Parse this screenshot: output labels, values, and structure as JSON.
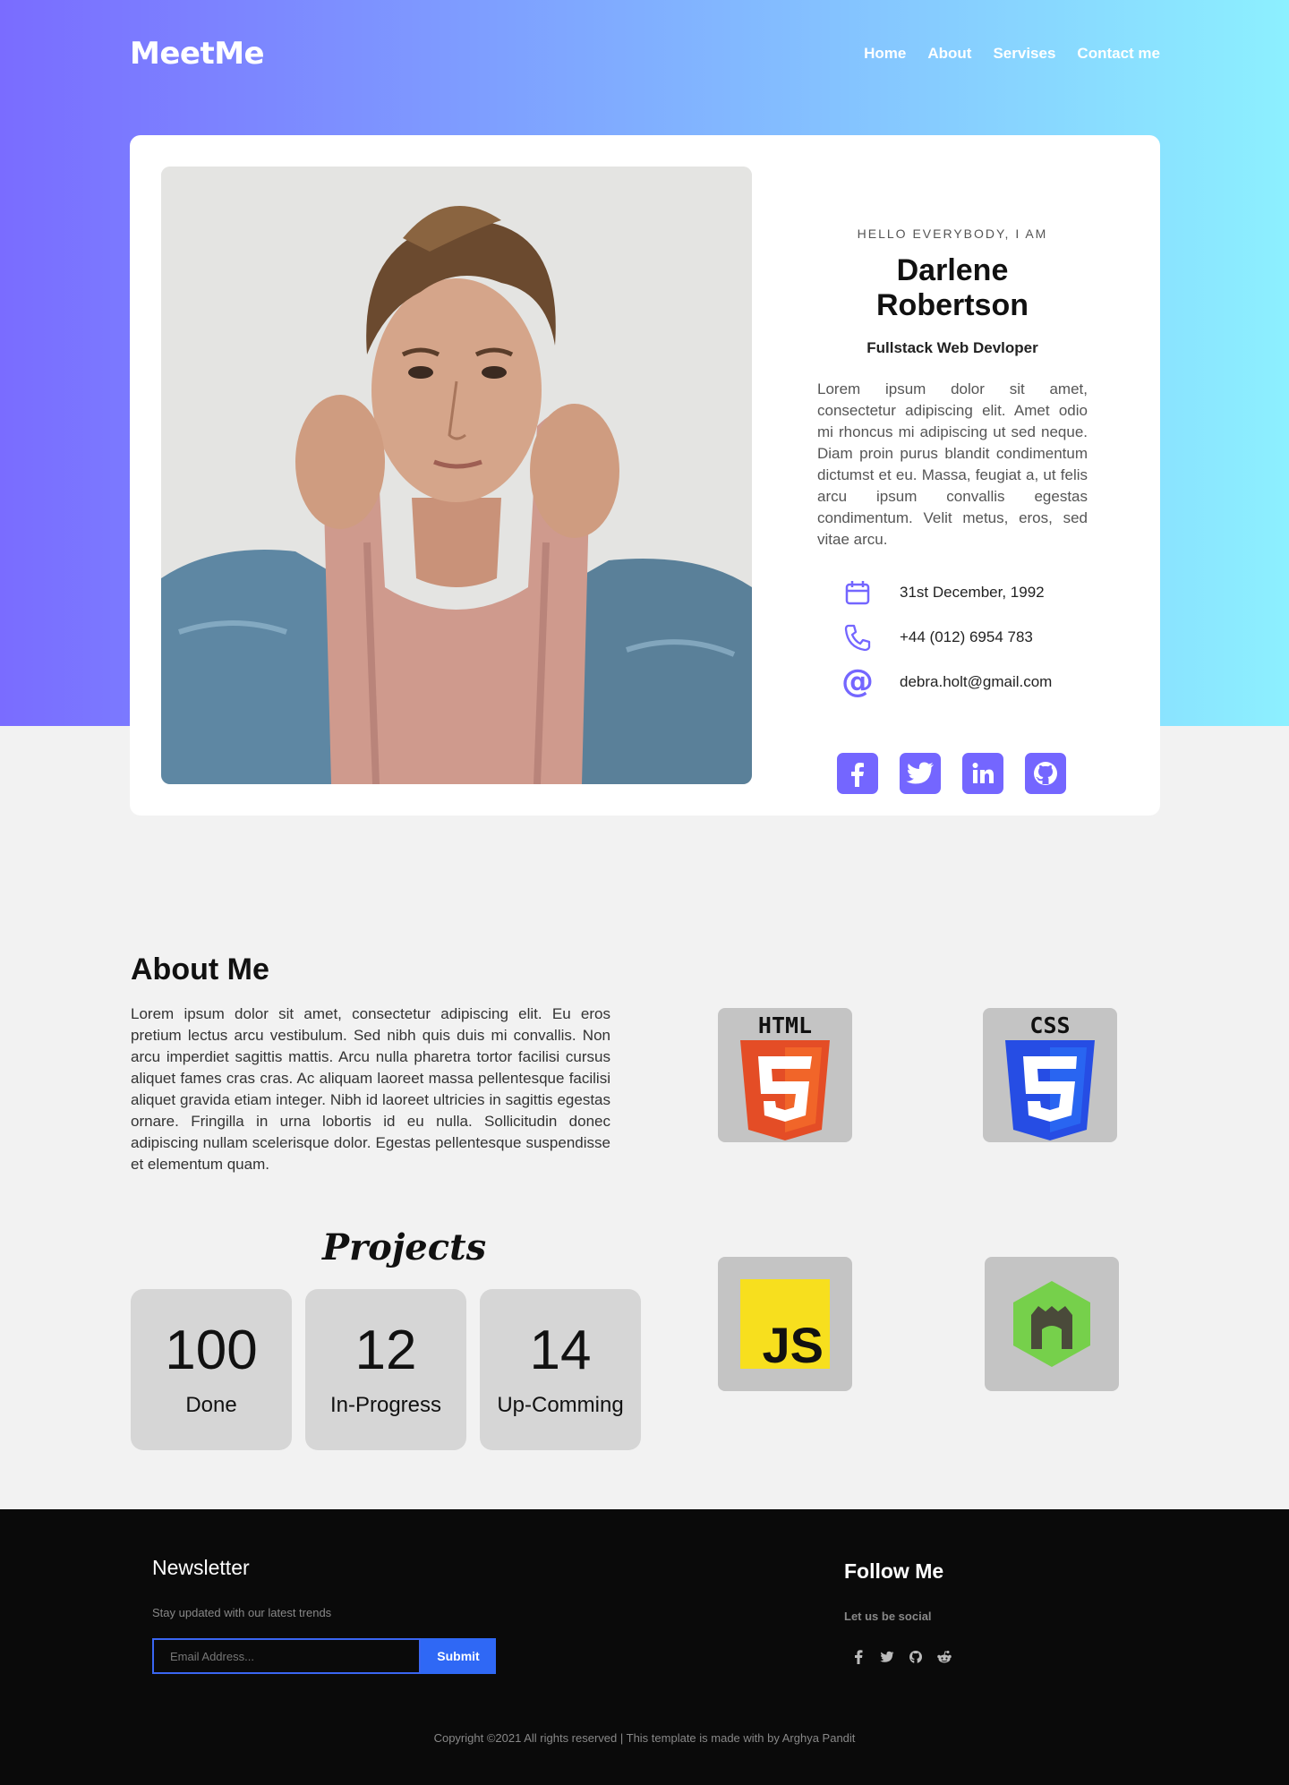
{
  "nav": {
    "logo": "MeetMe",
    "links": [
      "Home",
      "About",
      "Servises",
      "Contact me"
    ]
  },
  "profile": {
    "greeting": "HELLO EVERYBODY, I AM",
    "name": "Darlene Robertson",
    "role": "Fullstack Web Devloper",
    "bio": "Lorem ipsum dolor sit amet, consectetur adipiscing elit. Amet odio mi rhoncus mi adipiscing ut sed neque. Diam proin purus blandit condimentum dictumst et eu. Massa, feugiat a, ut felis arcu ipsum convallis egestas condimentum. Velit metus, eros, sed vitae arcu.",
    "birthday": "31st December, 1992",
    "phone": "+44 (012) 6954 783",
    "email": "debra.holt@gmail.com",
    "socials": [
      "facebook-icon",
      "twitter-icon",
      "linkedin-icon",
      "github-icon"
    ]
  },
  "about": {
    "title": "About Me",
    "text": "Lorem ipsum dolor sit amet, consectetur adipiscing elit. Eu eros pretium lectus arcu vestibulum. Sed nibh quis duis mi convallis. Non arcu imperdiet sagittis mattis. Arcu nulla pharetra tortor facilisi cursus aliquet fames cras cras. Ac aliquam laoreet massa pellentesque facilisi aliquet gravida etiam integer. Nibh id laoreet ultricies in sagittis egestas ornare. Fringilla in urna lobortis id eu nulla. Sollicitudin donec adipiscing nullam scelerisque dolor. Egestas pellentesque suspendisse et elementum quam."
  },
  "projects": {
    "title": "Projects",
    "stats": [
      {
        "value": "100",
        "label": "Done"
      },
      {
        "value": "12",
        "label": "In-Progress"
      },
      {
        "value": "14",
        "label": "Up-Comming"
      }
    ]
  },
  "tech": {
    "html_label": "HTML",
    "css_label": "CSS",
    "js_label": "JS"
  },
  "footer": {
    "newsletter_title": "Newsletter",
    "newsletter_sub": "Stay updated with our latest trends",
    "email_placeholder": "Email Address...",
    "submit_label": "Submit",
    "follow_title": "Follow Me",
    "follow_sub": "Let us be social",
    "follow_icons": [
      "facebook-icon",
      "twitter-icon",
      "github-icon",
      "reddit-icon"
    ],
    "copyright": "Copyright ©2021 All rights reserved | This template is made with  by Arghya Pandit"
  },
  "colors": {
    "accent": "#7466ff",
    "gradient_start": "#7a6cff",
    "gradient_end": "#8cf0ff",
    "submit": "#2f68f5"
  }
}
